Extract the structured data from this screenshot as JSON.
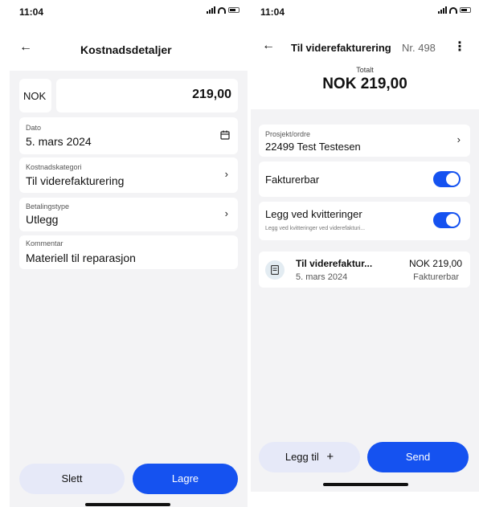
{
  "left": {
    "time": "11:04",
    "title": "Kostnadsdetaljer",
    "currency": "NOK",
    "amount": "219,00",
    "date": {
      "label": "Dato",
      "value": "5. mars 2024"
    },
    "category": {
      "label": "Kostnadskategori",
      "value": "Til viderefakturering"
    },
    "payment_type": {
      "label": "Betalingstype",
      "value": "Utlegg"
    },
    "comment": {
      "label": "Kommentar",
      "value": "Materiell til reparasjon"
    },
    "delete_label": "Slett",
    "save_label": "Lagre"
  },
  "right": {
    "time": "11:04",
    "title": "Til viderefakturering",
    "number": "Nr. 498",
    "total_label": "Totalt",
    "total_value": "NOK 219,00",
    "project": {
      "label": "Prosjekt/ordre",
      "value": "22499 Test Testesen"
    },
    "billable": {
      "label": "Fakturerbar",
      "on": true
    },
    "attach_receipts": {
      "label": "Legg ved kvitteringer",
      "sublabel": "Legg ved kvitteringer ved viderefakturi...",
      "on": true
    },
    "expense_item": {
      "title": "Til viderefaktur...",
      "amount": "NOK 219,00",
      "date": "5. mars 2024",
      "status": "Fakturerbar"
    },
    "add_label": "Legg til",
    "send_label": "Send"
  },
  "colors": {
    "accent": "#1552f0",
    "secondary_button": "#e6e9f8",
    "background": "#f3f3f5"
  }
}
